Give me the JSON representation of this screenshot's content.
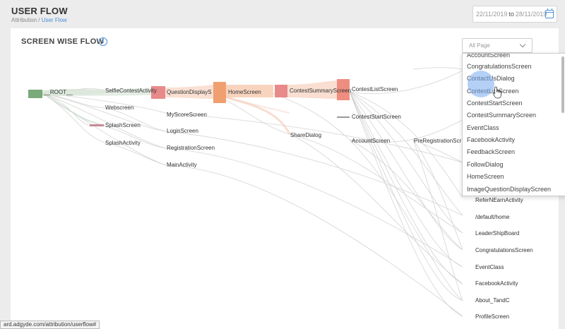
{
  "header": {
    "title": "USER FLOW",
    "breadcrumb_root": "Attribution",
    "breadcrumb_sep": " / ",
    "breadcrumb_current": "User Flow",
    "date_from": "22/11/2019",
    "date_to_label": "to",
    "date_to": "28/11/2019"
  },
  "card": {
    "title": "SCREEN WISE FLOW",
    "info_glyph": "i"
  },
  "flow": {
    "col0": [
      "__ROOT__"
    ],
    "col1": [
      "SelfieContestActivity",
      "Webscreen",
      "SplashScreen",
      "SplashActivity"
    ],
    "col2": [
      "QuestionDisplayS",
      "MyScoreScreen",
      "LoginScreen",
      "RegistrationScreen",
      "MainActivity"
    ],
    "col3": [
      "HomeScreen",
      "ShareDialog"
    ],
    "col4": [
      "ContestSummaryScreen",
      "AccountScreen"
    ],
    "col5": [
      "ContestListScreen",
      "ContestStartScreen",
      "PreRegistrationScr"
    ],
    "right_list": [
      "ReferNEarnActivity",
      "/default/home",
      "LeaderShipBoard",
      "CongratulationsScreen",
      "EventClass",
      "FacebookActivity",
      "About_TandC",
      "ProfileScreen"
    ]
  },
  "filter": {
    "selected": "All Page",
    "options": [
      "AccountScreen",
      "CongratulationsScreen",
      "ContactUsDialog",
      "ContestListScreen",
      "ContestStartScreen",
      "ContestSummaryScreen",
      "EventClass",
      "FacebookActivity",
      "FeedbackScreen",
      "FollowDialog",
      "HomeScreen",
      "ImageQuestionDisplayScreen"
    ]
  },
  "status_bar": {
    "url": "ard.adgyde.com/attribution/userflow#"
  },
  "colors": {
    "accent": "#4a90d9",
    "root_node": "#7aa97a",
    "pink_node": "#e88a8a",
    "orange_node": "#f0a070",
    "orange_band": "#f6c9ae"
  }
}
